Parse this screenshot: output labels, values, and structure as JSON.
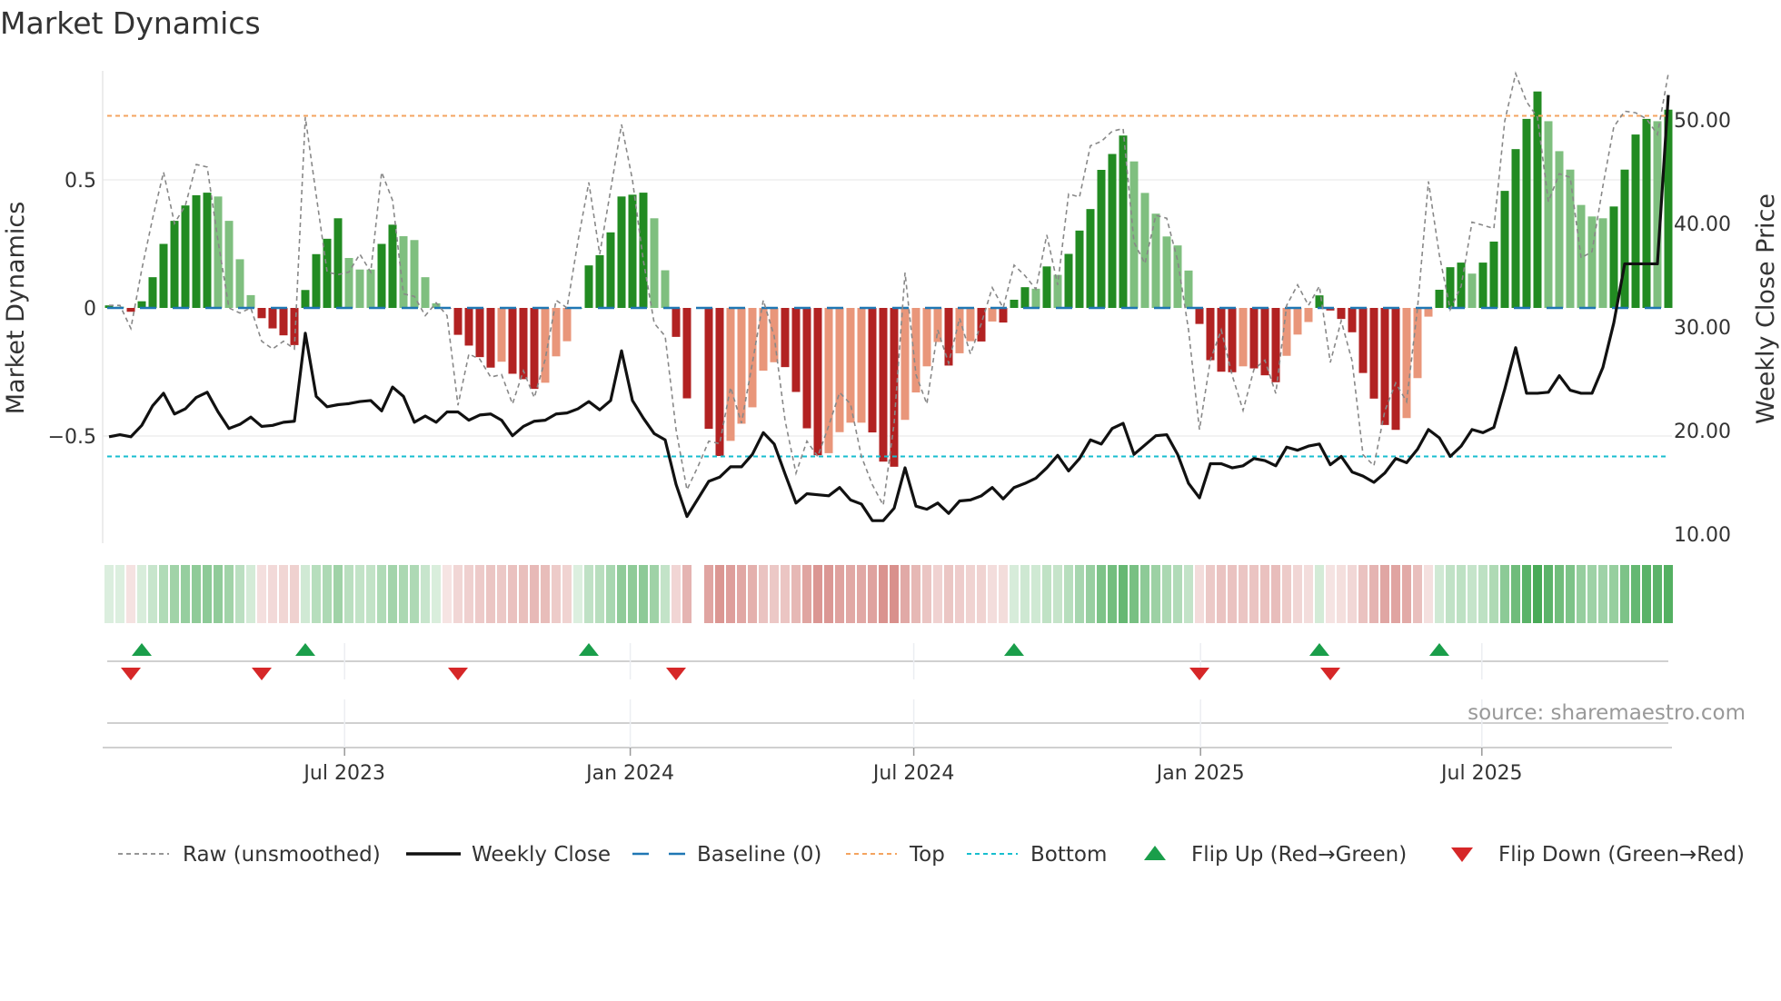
{
  "title": "Market Dynamics",
  "source": "source: sharemaestro.com",
  "colors": {
    "strong_green": "#228b22",
    "weak_green": "#7fbf7f",
    "strong_red": "#b22222",
    "weak_red": "#e9967a",
    "raw": "#888888",
    "close": "#111111",
    "baseline": "#1f77b4",
    "top": "#f4a460",
    "bottom": "#17becf",
    "flip_up": "#1a9e4a",
    "flip_down": "#d62728",
    "strip_green": "#3fa64f",
    "strip_red": "#cc6b66"
  },
  "legend": [
    {
      "key": "raw",
      "label": "Raw (unsmoothed)"
    },
    {
      "key": "close",
      "label": "Weekly Close"
    },
    {
      "key": "baseline",
      "label": "Baseline (0)"
    },
    {
      "key": "top",
      "label": "Top"
    },
    {
      "key": "bottom",
      "label": "Bottom"
    },
    {
      "key": "flip_up",
      "label": "Flip Up (Red→Green)"
    },
    {
      "key": "flip_down",
      "label": "Flip Down (Green→Red)"
    }
  ],
  "chart_data": {
    "type": "bar",
    "title": "Market Dynamics",
    "ylabel": "Market Dynamics",
    "y2label": "Weekly Close Price",
    "x_unit": "week index",
    "ylim": [
      -0.92,
      0.925
    ],
    "y2lim": [
      9.1,
      54.7
    ],
    "yticks": [
      {
        "v": 0.5,
        "label": "0.5"
      },
      {
        "v": 0,
        "label": "0"
      },
      {
        "v": -0.5,
        "label": "−0.5"
      }
    ],
    "y2ticks": [
      {
        "v": 50,
        "label": "50.00"
      },
      {
        "v": 40,
        "label": "40.00"
      },
      {
        "v": 30,
        "label": "30.00"
      },
      {
        "v": 20,
        "label": "20.00"
      },
      {
        "v": 10,
        "label": "10.00"
      }
    ],
    "xticks": [
      {
        "i": 21.6,
        "label": "Jul 2023"
      },
      {
        "i": 47.8,
        "label": "Jan 2024"
      },
      {
        "i": 73.8,
        "label": "Jul 2024"
      },
      {
        "i": 100.1,
        "label": "Jan 2025"
      },
      {
        "i": 125.9,
        "label": "Jul 2025"
      }
    ],
    "top": 0.75,
    "bottom": -0.58,
    "baseline": 0,
    "values": [
      0.01,
      0.005,
      -0.015,
      0.026,
      0.12,
      0.25,
      0.34,
      0.4,
      0.44,
      0.45,
      0.435,
      0.34,
      0.19,
      0.05,
      -0.04,
      -0.08,
      -0.107,
      -0.145,
      0.07,
      0.21,
      0.27,
      0.35,
      0.195,
      0.15,
      0.15,
      0.25,
      0.325,
      0.28,
      0.265,
      0.12,
      0.018,
      -0.003,
      -0.105,
      -0.147,
      -0.192,
      -0.233,
      -0.21,
      -0.257,
      -0.278,
      -0.316,
      -0.292,
      -0.189,
      -0.13,
      0.0,
      0.166,
      0.206,
      0.295,
      0.435,
      0.442,
      0.45,
      0.35,
      0.147,
      -0.113,
      -0.353,
      null,
      -0.472,
      -0.578,
      -0.519,
      -0.452,
      -0.388,
      -0.245,
      -0.212,
      -0.231,
      -0.328,
      -0.47,
      -0.575,
      -0.567,
      -0.485,
      -0.448,
      -0.448,
      -0.486,
      -0.6,
      -0.62,
      -0.437,
      -0.33,
      -0.228,
      -0.133,
      -0.225,
      -0.177,
      -0.13,
      -0.131,
      -0.053,
      -0.057,
      0.032,
      0.081,
      0.075,
      0.162,
      0.129,
      0.211,
      0.302,
      0.386,
      0.539,
      0.601,
      0.673,
      0.572,
      0.449,
      0.368,
      0.279,
      0.244,
      0.146,
      -0.0625,
      -0.204,
      -0.249,
      -0.251,
      -0.228,
      -0.236,
      -0.263,
      -0.29,
      -0.187,
      -0.104,
      -0.055,
      0.049,
      -0.01,
      -0.043,
      -0.095,
      -0.254,
      -0.354,
      -0.457,
      -0.476,
      -0.43,
      -0.274,
      -0.034,
      0.071,
      0.159,
      0.177,
      0.134,
      0.177,
      0.259,
      0.457,
      0.62,
      0.738,
      0.845,
      0.729,
      0.612,
      0.54,
      0.402,
      0.357,
      0.35,
      0.396,
      0.54,
      0.677,
      0.738,
      0.729,
      0.774
    ],
    "raw": [
      0.01,
      0.01,
      -0.08,
      0.15,
      0.35,
      0.53,
      0.33,
      0.4,
      0.56,
      0.55,
      0.26,
      0,
      -0.02,
      0,
      -0.13,
      -0.16,
      -0.13,
      -0.16,
      0.745,
      0.44,
      0.14,
      0.13,
      0.14,
      0.21,
      0.14,
      0.53,
      0.42,
      0.055,
      0.045,
      -0.03,
      0.02,
      -0.03,
      -0.38,
      -0.18,
      -0.2,
      -0.27,
      -0.26,
      -0.375,
      -0.245,
      -0.35,
      -0.2,
      0.03,
      0.0,
      0.26,
      0.49,
      0.21,
      0.46,
      0.716,
      0.5,
      0.185,
      -0.06,
      -0.11,
      -0.475,
      -0.71,
      -0.62,
      -0.52,
      -0.53,
      -0.31,
      -0.45,
      -0.215,
      0.03,
      -0.11,
      -0.44,
      -0.645,
      -0.52,
      -0.58,
      -0.46,
      -0.33,
      -0.375,
      -0.58,
      -0.69,
      -0.77,
      -0.45,
      0.138,
      -0.26,
      -0.375,
      -0.086,
      -0.216,
      -0.04,
      -0.18,
      -0.06,
      0.079,
      0,
      0.167,
      0.126,
      0.073,
      0.285,
      0.09,
      0.445,
      0.433,
      0.633,
      0.65,
      0.69,
      0.7,
      0.256,
      0.173,
      0.362,
      0.35,
      0.185,
      -0.086,
      -0.475,
      -0.204,
      -0.086,
      -0.263,
      -0.4,
      -0.24,
      -0.204,
      -0.334,
      0.01,
      0.09,
      0.01,
      0.085,
      -0.213,
      -0.05,
      -0.207,
      -0.573,
      -0.616,
      -0.402,
      -0.293,
      -0.366,
      0,
      0.494,
      0.207,
      -0.006,
      0.085,
      0.335,
      0.323,
      0.31,
      0.73,
      0.915,
      0.805,
      0.744,
      0.415,
      0.524,
      0.51,
      0.195,
      0.22,
      0.476,
      0.707,
      0.768,
      0.762,
      0.738,
      0.677,
      0.915
    ],
    "close": [
      19.4,
      19.6,
      19.4,
      20.5,
      22.4,
      23.6,
      21.6,
      22.1,
      23.2,
      23.7,
      21.8,
      20.2,
      20.6,
      21.3,
      20.4,
      20.5,
      20.8,
      20.9,
      29.4,
      23.3,
      22.3,
      22.5,
      22.6,
      22.8,
      22.9,
      21.9,
      24.2,
      23.3,
      20.8,
      21.4,
      20.8,
      21.8,
      21.8,
      21.0,
      21.5,
      21.6,
      21.0,
      19.5,
      20.4,
      20.9,
      21.0,
      21.6,
      21.7,
      22.1,
      22.8,
      22.0,
      22.9,
      27.7,
      22.9,
      21.2,
      19.7,
      19.1,
      14.8,
      11.7,
      13.4,
      15.1,
      15.5,
      16.5,
      16.5,
      17.7,
      19.8,
      18.7,
      15.8,
      13.0,
      13.9,
      13.8,
      13.7,
      14.5,
      13.3,
      12.9,
      11.3,
      11.3,
      12.5,
      16.4,
      12.7,
      12.4,
      13.0,
      12.0,
      13.2,
      13.3,
      13.7,
      14.5,
      13.4,
      14.5,
      14.9,
      15.4,
      16.4,
      17.6,
      16.1,
      17.3,
      19.1,
      18.7,
      20.2,
      20.7,
      17.7,
      18.6,
      19.5,
      19.6,
      17.7,
      14.9,
      13.5,
      16.8,
      16.8,
      16.4,
      16.6,
      17.3,
      17.1,
      16.6,
      18.4,
      18.1,
      18.5,
      18.7,
      16.7,
      17.5,
      16.0,
      15.6,
      15.0,
      15.9,
      17.3,
      16.9,
      18.2,
      20.1,
      19.3,
      17.5,
      18.5,
      20.1,
      19.8,
      20.3,
      24.0,
      28.0,
      23.6,
      23.6,
      23.7,
      25.3,
      23.9,
      23.6,
      23.6,
      26.1,
      30.4,
      36.1,
      36.1,
      36.1,
      36.1,
      52.4
    ],
    "flip_up": [
      3,
      18,
      44,
      83,
      111,
      122
    ],
    "flip_down": [
      2,
      14,
      32,
      52,
      100,
      112
    ]
  }
}
